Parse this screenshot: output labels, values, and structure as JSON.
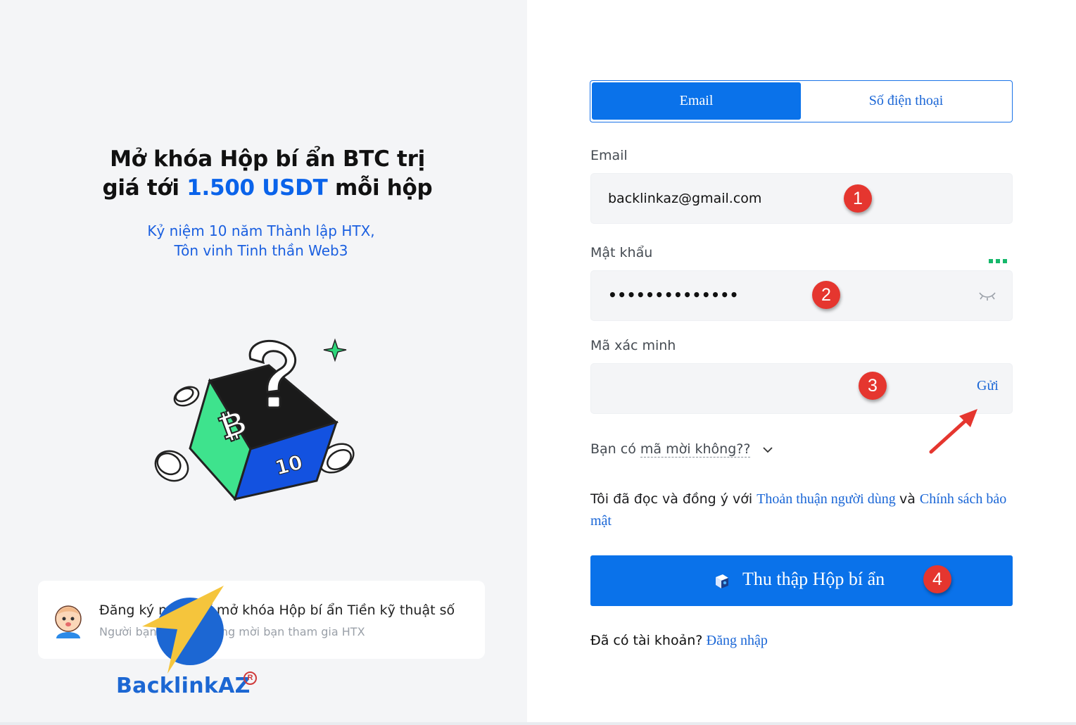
{
  "hero": {
    "title_part1": "Mở khóa Hộp bí ẩn BTC trị",
    "title_part2": "giá tới",
    "title_highlight": "1.500 USDT",
    "title_part3": "mỗi hộp",
    "subtitle_line1": "Kỷ niệm 10 năm Thành lập HTX,",
    "subtitle_line2": "Tôn vinh Tinh thần Web3",
    "illustration_logo_text": "10"
  },
  "invite_card": {
    "title": "Đăng ký ngay để mở khóa Hộp bí ẩn Tiền kỹ thuật số",
    "subtitle": "Người bạn 123456 đang mời bạn tham gia HTX"
  },
  "watermark": {
    "text": "BacklinkAZ",
    "registered": "R"
  },
  "tabs": {
    "email": "Email",
    "phone": "Số điện thoại",
    "active": "email"
  },
  "form": {
    "email_label": "Email",
    "email_value": "backlinkaz@gmail.com",
    "password_label": "Mật khẩu",
    "password_masked": "••••••••••••••",
    "code_label": "Mã xác minh",
    "code_value": "",
    "send_label": "Gửi",
    "invite_prefix": "Bạn có ",
    "invite_underlined": "mã mời không??",
    "terms_text": "Tôi đã đọc và đồng ý với ",
    "terms_link": "Thoản thuận người dùng",
    "terms_and": " và ",
    "privacy_link": "Chính sách bảo mật",
    "submit_label": "Thu thập Hộp bí ẩn",
    "login_prompt": "Đã có tài khoản?",
    "login_link": "Đăng nhập"
  },
  "annotations": {
    "step1": "1",
    "step2": "2",
    "step3": "3",
    "step4": "4"
  },
  "colors": {
    "primary": "#0a72ea",
    "link": "#1a66d6",
    "highlight": "#0a63ea",
    "annotation_red": "#e5362f",
    "strength_green": "#16b86b",
    "left_panel_bg": "#f4f5f7"
  }
}
